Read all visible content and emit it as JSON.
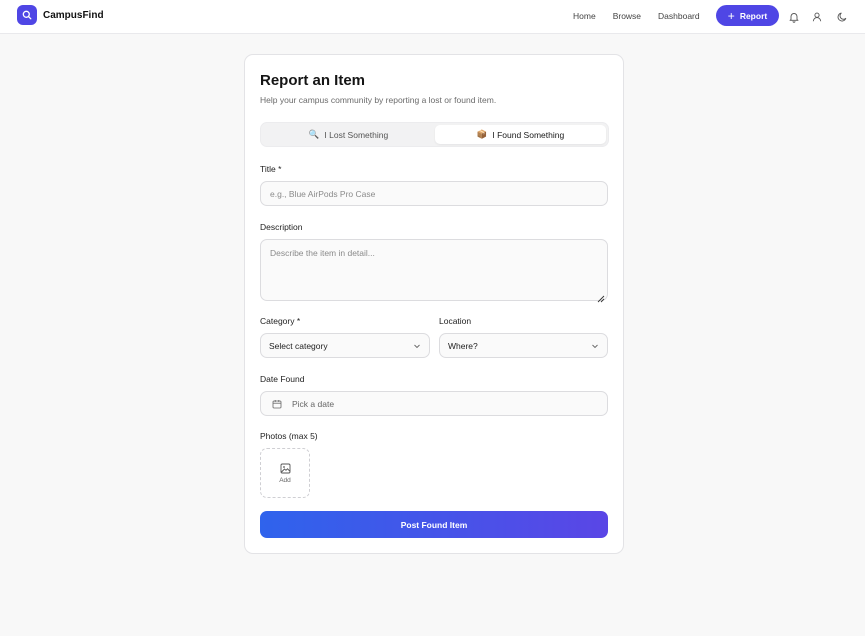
{
  "app": {
    "name": "CampusFind"
  },
  "nav": {
    "links": [
      "Home",
      "Browse",
      "Dashboard"
    ],
    "report_label": "Report"
  },
  "icons": {
    "brand": "search-icon",
    "notifications": "bell-icon",
    "profile": "user-icon",
    "theme": "moon-icon"
  },
  "colors": {
    "accent": "#4f46e5",
    "submit_start": "#2f63ec",
    "submit_end": "#5a46e6"
  },
  "form": {
    "title": "Report an Item",
    "subtitle": "Help your campus community by reporting a lost or found item.",
    "mode_tabs": [
      {
        "label": "I Lost Something",
        "icon": "🔍",
        "active": false
      },
      {
        "label": "I Found Something",
        "icon": "📦",
        "active": true
      }
    ],
    "title_field": {
      "label": "Title *",
      "placeholder": "e.g., Blue AirPods Pro Case",
      "value": ""
    },
    "description_field": {
      "label": "Description",
      "placeholder": "Describe the item in detail...",
      "value": ""
    },
    "category_field": {
      "label": "Category *",
      "value": "Select category"
    },
    "location_field": {
      "label": "Location",
      "value": "Where?"
    },
    "date_field": {
      "label": "Date Found",
      "placeholder": "Pick a date"
    },
    "photos": {
      "label": "Photos (max 5)",
      "add_label": "Add"
    },
    "submit_label": "Post Found Item"
  }
}
